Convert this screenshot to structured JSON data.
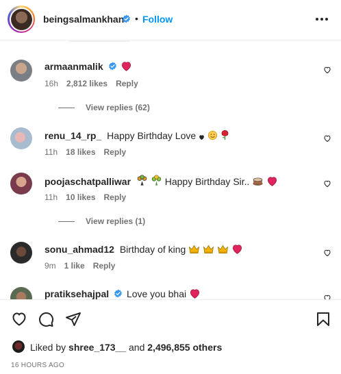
{
  "header": {
    "username": "beingsalmankhan",
    "separator": "•",
    "follow_label": "Follow"
  },
  "comments": [
    {
      "username": "armaanmalik",
      "verified": true,
      "text": "",
      "time": "16h",
      "likes": "2,812 likes",
      "reply_label": "Reply",
      "view_replies": "View replies (62)"
    },
    {
      "username": "renu_14_rp_",
      "verified": false,
      "text": "Happy Birthday Love",
      "time": "11h",
      "likes": "18 likes",
      "reply_label": "Reply"
    },
    {
      "username": "poojaschatpalliwar",
      "verified": false,
      "text": "Happy Birthday Sir..",
      "time": "11h",
      "likes": "10 likes",
      "reply_label": "Reply",
      "view_replies": "View replies (1)"
    },
    {
      "username": "sonu_ahmad12",
      "verified": false,
      "text": "Birthday of king",
      "time": "9m",
      "likes": "1 like",
      "reply_label": "Reply"
    },
    {
      "username": "pratiksehajpal",
      "verified": true,
      "text": "Love you bhai"
    }
  ],
  "likes_bar": {
    "prefix": "Liked by",
    "liker": "shree_173__",
    "and": "and",
    "others": "2,496,855 others"
  },
  "timestamp": "16 HOURS AGO",
  "colors": {
    "follow_blue": "#0095f6",
    "verified_blue": "#3897f0",
    "heart_red": "#e0245e",
    "meta_gray": "#737373"
  }
}
